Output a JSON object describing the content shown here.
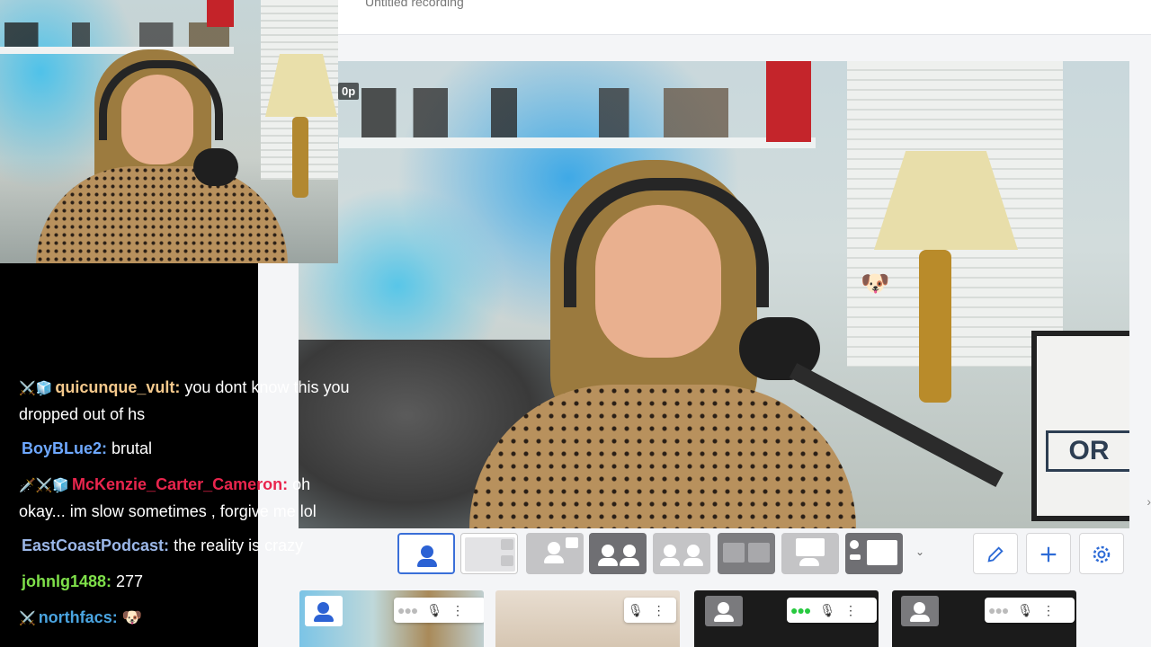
{
  "recording_title": "Untitled recording",
  "stage_badge": "0p",
  "stage_logo_text": "OR",
  "chat": [
    {
      "icons": "⚔️🧊",
      "user": "quicunque_vult:",
      "color": "#f5c98c",
      "text": " you dont know this you dropped out of hs"
    },
    {
      "icons": "",
      "user": "BoyBLue2:",
      "color": "#6ea8ff",
      "text": " brutal"
    },
    {
      "icons": "🗡️⚔️🧊",
      "user": "McKenzie_Carter_Cameron:",
      "color": "#e9254d",
      "text": " oh okay... im slow sometimes , forgive me lol"
    },
    {
      "icons": "",
      "user": "EastCoastPodcast:",
      "color": "#9bb7e8",
      "text": " the reality is crazy"
    },
    {
      "icons": "",
      "user": "johnlg1488:",
      "color": "#7fe04a",
      "text": " 277"
    },
    {
      "icons": "⚔️",
      "user": "northfacs:",
      "color": "#4aa4e0",
      "text": " 🐶"
    }
  ],
  "layouts": [
    {
      "name": "solo",
      "active": true
    },
    {
      "name": "grid-small",
      "active": false
    },
    {
      "name": "pip",
      "active": false
    },
    {
      "name": "two-up",
      "active": false
    },
    {
      "name": "two-up-alt",
      "active": false
    },
    {
      "name": "side-by-side",
      "active": false
    },
    {
      "name": "screen",
      "active": false
    },
    {
      "name": "screen-list",
      "active": false
    }
  ],
  "tools": {
    "edit": "edit-icon",
    "add": "plus-icon",
    "settings": "gear-icon"
  },
  "participants": [
    {
      "tile": "self",
      "mic": "mic-icon",
      "status": "idle"
    },
    {
      "tile": "guest-1",
      "mic": "mic-icon",
      "status": "idle"
    },
    {
      "tile": "guest-2",
      "mic": "mic-icon",
      "status": "speaking"
    },
    {
      "tile": "guest-3",
      "mic": "mic-icon",
      "status": "idle"
    }
  ],
  "colors": {
    "accent": "#2c62d4",
    "speaking": "#27c93f"
  }
}
